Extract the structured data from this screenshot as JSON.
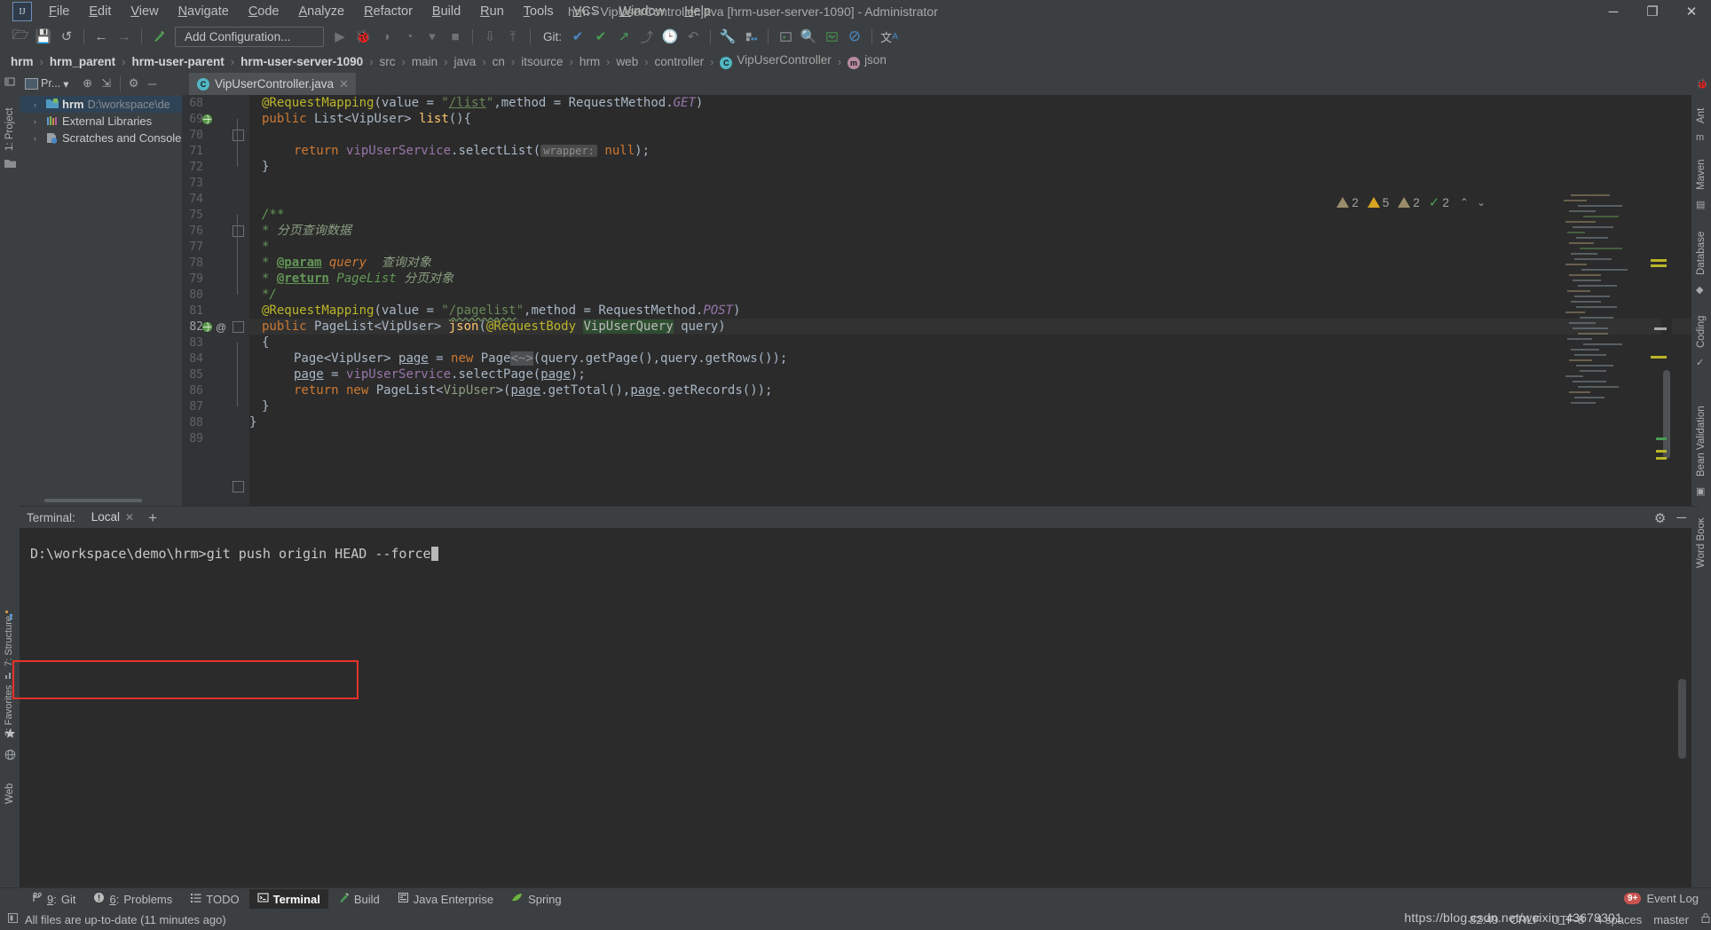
{
  "window": {
    "title": "hrm - VipUserController.java [hrm-user-server-1090] - Administrator",
    "minimize": "─",
    "maximize": "❐",
    "close": "✕",
    "logo": "IJ"
  },
  "menu": {
    "items": [
      "File",
      "Edit",
      "View",
      "Navigate",
      "Code",
      "Analyze",
      "Refactor",
      "Build",
      "Run",
      "Tools",
      "VCS",
      "Window",
      "Help"
    ]
  },
  "toolbar": {
    "open_icon": "🗁",
    "save_icon": "💾",
    "sync_icon": "↺",
    "back_icon": "←",
    "forward_icon": "→",
    "build_icon": "⬉",
    "run_config_label": "Add Configuration...",
    "run_icon": "▶",
    "debug_icon": "🐞",
    "coverage_icon": "◑",
    "profile_icon": "◔",
    "dropdown_icon": "▾",
    "stop_icon": "■",
    "update_icon": "⇩",
    "commit_icon": "⤒",
    "git_label": "Git:",
    "git_check_icon": "✔",
    "git_update_icon": "↗",
    "git_push_icon": "⤴",
    "history_icon": "🕒",
    "rollback_icon": "↶",
    "settings_icon": "🔧",
    "structure_icon": "▤",
    "terminal_icon": "▷",
    "search_icon": "🔍",
    "chart_icon": "⌇",
    "block_icon": "⊘",
    "translate_icon": "文A"
  },
  "breadcrumb": {
    "items": [
      {
        "label": "hrm",
        "bold": true,
        "icon": null
      },
      {
        "label": "hrm_parent",
        "bold": true,
        "icon": null
      },
      {
        "label": "hrm-user-parent",
        "bold": true,
        "icon": null
      },
      {
        "label": "hrm-user-server-1090",
        "bold": true,
        "icon": null
      },
      {
        "label": "src",
        "bold": false,
        "icon": null
      },
      {
        "label": "main",
        "bold": false,
        "icon": null
      },
      {
        "label": "java",
        "bold": false,
        "icon": null
      },
      {
        "label": "cn",
        "bold": false,
        "icon": null
      },
      {
        "label": "itsource",
        "bold": false,
        "icon": null
      },
      {
        "label": "hrm",
        "bold": false,
        "icon": null
      },
      {
        "label": "web",
        "bold": false,
        "icon": null
      },
      {
        "label": "controller",
        "bold": false,
        "icon": null
      },
      {
        "label": "VipUserController",
        "bold": false,
        "icon": "class"
      },
      {
        "label": "json",
        "bold": false,
        "icon": "method"
      }
    ],
    "separator": "›"
  },
  "left_rail": {
    "project_label": "1: Project",
    "structure_label": "7: Structure",
    "favorites_label": "2: Favorites",
    "web_label": "Web"
  },
  "right_rail": {
    "items": [
      "Ant",
      "Maven",
      "Database",
      "Coding",
      "Bean Validation",
      "Word Book"
    ]
  },
  "project_panel": {
    "title": "Pr...",
    "dropdown_icon": "▾",
    "locate_icon": "⊕",
    "collapse_icon": "⇲",
    "settings_icon": "⚙",
    "hide_icon": "─",
    "tree": [
      {
        "label": "hrm",
        "path": "D:\\workspace\\de",
        "bold": true,
        "selected": true,
        "arrow": "›",
        "icon": "module"
      },
      {
        "label": "External Libraries",
        "path": "",
        "bold": false,
        "selected": false,
        "arrow": "›",
        "icon": "libs"
      },
      {
        "label": "Scratches and Console",
        "path": "",
        "bold": false,
        "selected": false,
        "arrow": "›",
        "icon": "scratch"
      }
    ]
  },
  "editor": {
    "tab": {
      "name": "VipUserController.java",
      "icon": "C",
      "close": "✕"
    },
    "inspections": [
      {
        "icon": "warn-weak",
        "count": "2"
      },
      {
        "icon": "warn",
        "count": "5"
      },
      {
        "icon": "warn-weak",
        "count": "2"
      },
      {
        "icon": "check",
        "count": "2"
      }
    ],
    "nav_up": "⌃",
    "nav_down": "⌄",
    "first_line": 68,
    "current_line": 82,
    "lines": [
      {
        "n": 68,
        "fold": null,
        "gutter_icon": null
      },
      {
        "n": 69,
        "fold": "open",
        "gutter_icon": "web"
      },
      {
        "n": 70,
        "fold": null,
        "gutter_icon": null
      },
      {
        "n": 71,
        "fold": null,
        "gutter_icon": null
      },
      {
        "n": 72,
        "fold": "close",
        "gutter_icon": null
      },
      {
        "n": 73,
        "fold": null,
        "gutter_icon": null
      },
      {
        "n": 74,
        "fold": null,
        "gutter_icon": null
      },
      {
        "n": 75,
        "fold": "open",
        "gutter_icon": null
      },
      {
        "n": 76,
        "fold": null,
        "gutter_icon": null
      },
      {
        "n": 77,
        "fold": null,
        "gutter_icon": null
      },
      {
        "n": 78,
        "fold": null,
        "gutter_icon": null
      },
      {
        "n": 79,
        "fold": null,
        "gutter_icon": null
      },
      {
        "n": 80,
        "fold": "close",
        "gutter_icon": null
      },
      {
        "n": 81,
        "fold": null,
        "gutter_icon": null
      },
      {
        "n": 82,
        "fold": null,
        "gutter_icon": "web-override"
      },
      {
        "n": 83,
        "fold": "open",
        "gutter_icon": null
      },
      {
        "n": 84,
        "fold": null,
        "gutter_icon": null
      },
      {
        "n": 85,
        "fold": null,
        "gutter_icon": null
      },
      {
        "n": 86,
        "fold": null,
        "gutter_icon": null
      },
      {
        "n": 87,
        "fold": "close",
        "gutter_icon": null
      },
      {
        "n": 88,
        "fold": null,
        "gutter_icon": null
      },
      {
        "n": 89,
        "fold": null,
        "gutter_icon": null
      }
    ],
    "source_text": [
      "    @RequestMapping(value = \"/list\",method = RequestMethod.GET)",
      "    public List<VipUser> list(){",
      "",
      "        return vipUserService.selectList( wrapper: null);",
      "    }",
      "",
      "",
      "    /**",
      "     * 分页查询数据",
      "     *",
      "     * @param query 查询对象",
      "     * @return PageList 分页对象",
      "     */",
      "    @RequestMapping(value = \"/pagelist\",method = RequestMethod.POST)",
      "    public PageList<VipUser> json(@RequestBody VipUserQuery query)",
      "    {",
      "        Page<VipUser> page = new Page<~>(query.getPage(),query.getRows());",
      "        page = vipUserService.selectPage(page);",
      "        return new PageList<VipUser>(page.getTotal(),page.getRecords());",
      "    }",
      "}",
      ""
    ]
  },
  "terminal": {
    "label": "Terminal:",
    "tab": "Local",
    "tab_close": "✕",
    "add_tab": "+",
    "settings_icon": "⚙",
    "hide_icon": "─",
    "prompt": "D:\\workspace\\demo\\hrm>",
    "command": "git push origin HEAD --force"
  },
  "toolwindows": {
    "items": [
      {
        "num": "9",
        "label": "Git",
        "icon": "branch-icon",
        "active": false
      },
      {
        "num": "6",
        "label": "Problems",
        "icon": "problems-icon",
        "active": false
      },
      {
        "num": "",
        "label": "TODO",
        "icon": "todo-icon",
        "active": false
      },
      {
        "num": "",
        "label": "Terminal",
        "icon": "terminal-icon",
        "active": true
      },
      {
        "num": "",
        "label": "Build",
        "icon": "build-icon",
        "active": false
      },
      {
        "num": "",
        "label": "Java Enterprise",
        "icon": "java-enterprise-icon",
        "active": false
      },
      {
        "num": "",
        "label": "Spring",
        "icon": "spring-icon",
        "active": false
      }
    ],
    "event_log": {
      "label": "Event Log",
      "badge": "9+"
    }
  },
  "status_bar": {
    "message": "All files are up-to-date (11 minutes ago)",
    "caret_position": "82:49",
    "line_separator": "CRLF",
    "encoding": "UTF-8",
    "indent": "4 spaces",
    "branch": "master",
    "watermark": "https://blog.csdn.net/weixin_43678301"
  },
  "colors": {
    "bg_chrome": "#3c3f41",
    "bg_editor": "#2b2b2b",
    "bg_gutter": "#313335",
    "accent_blue": "#4a88c7",
    "annotation": "#bbb529",
    "keyword": "#cc7832",
    "string": "#6a8759",
    "comment": "#629755",
    "field": "#9876aa",
    "method": "#ffc66d",
    "text": "#a9b7c6",
    "red_box": "#e8312a",
    "selection": "#2f4357"
  }
}
